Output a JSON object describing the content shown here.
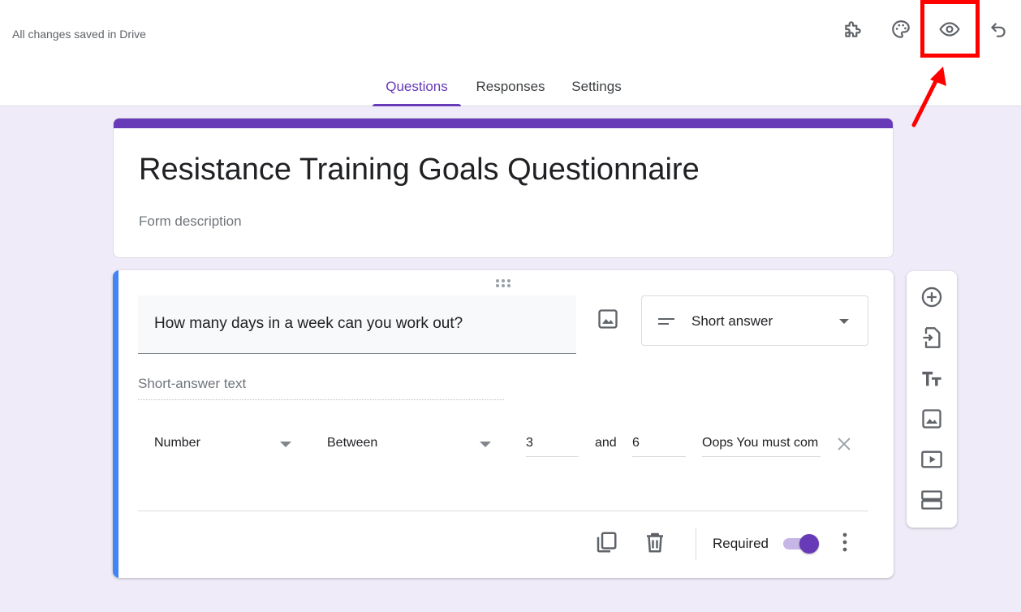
{
  "header": {
    "save_status": "All changes saved in Drive",
    "icons": [
      "add-ons-icon",
      "palette-icon",
      "preview-eye-icon",
      "undo-icon"
    ]
  },
  "tabs": [
    {
      "label": "Questions",
      "active": true
    },
    {
      "label": "Responses",
      "active": false
    },
    {
      "label": "Settings",
      "active": false
    }
  ],
  "form": {
    "title": "Resistance Training Goals Questionnaire",
    "description_placeholder": "Form description"
  },
  "question": {
    "text": "How many days in a week can you work out?",
    "type": "Short answer",
    "answer_placeholder": "Short-answer text",
    "validation": {
      "kind": "Number",
      "condition": "Between",
      "min": "3",
      "and_label": "and",
      "max": "6",
      "error_text": "Oops You must com"
    },
    "required_label": "Required",
    "required": true
  },
  "side_toolbar": [
    "add-question-icon",
    "import-questions-icon",
    "add-title-icon",
    "add-image-icon",
    "add-video-icon",
    "add-section-icon"
  ],
  "colors": {
    "accent": "#673ab7",
    "background": "#f0ebf8",
    "active_bar": "#4285f4",
    "highlight": "#ff0000"
  }
}
